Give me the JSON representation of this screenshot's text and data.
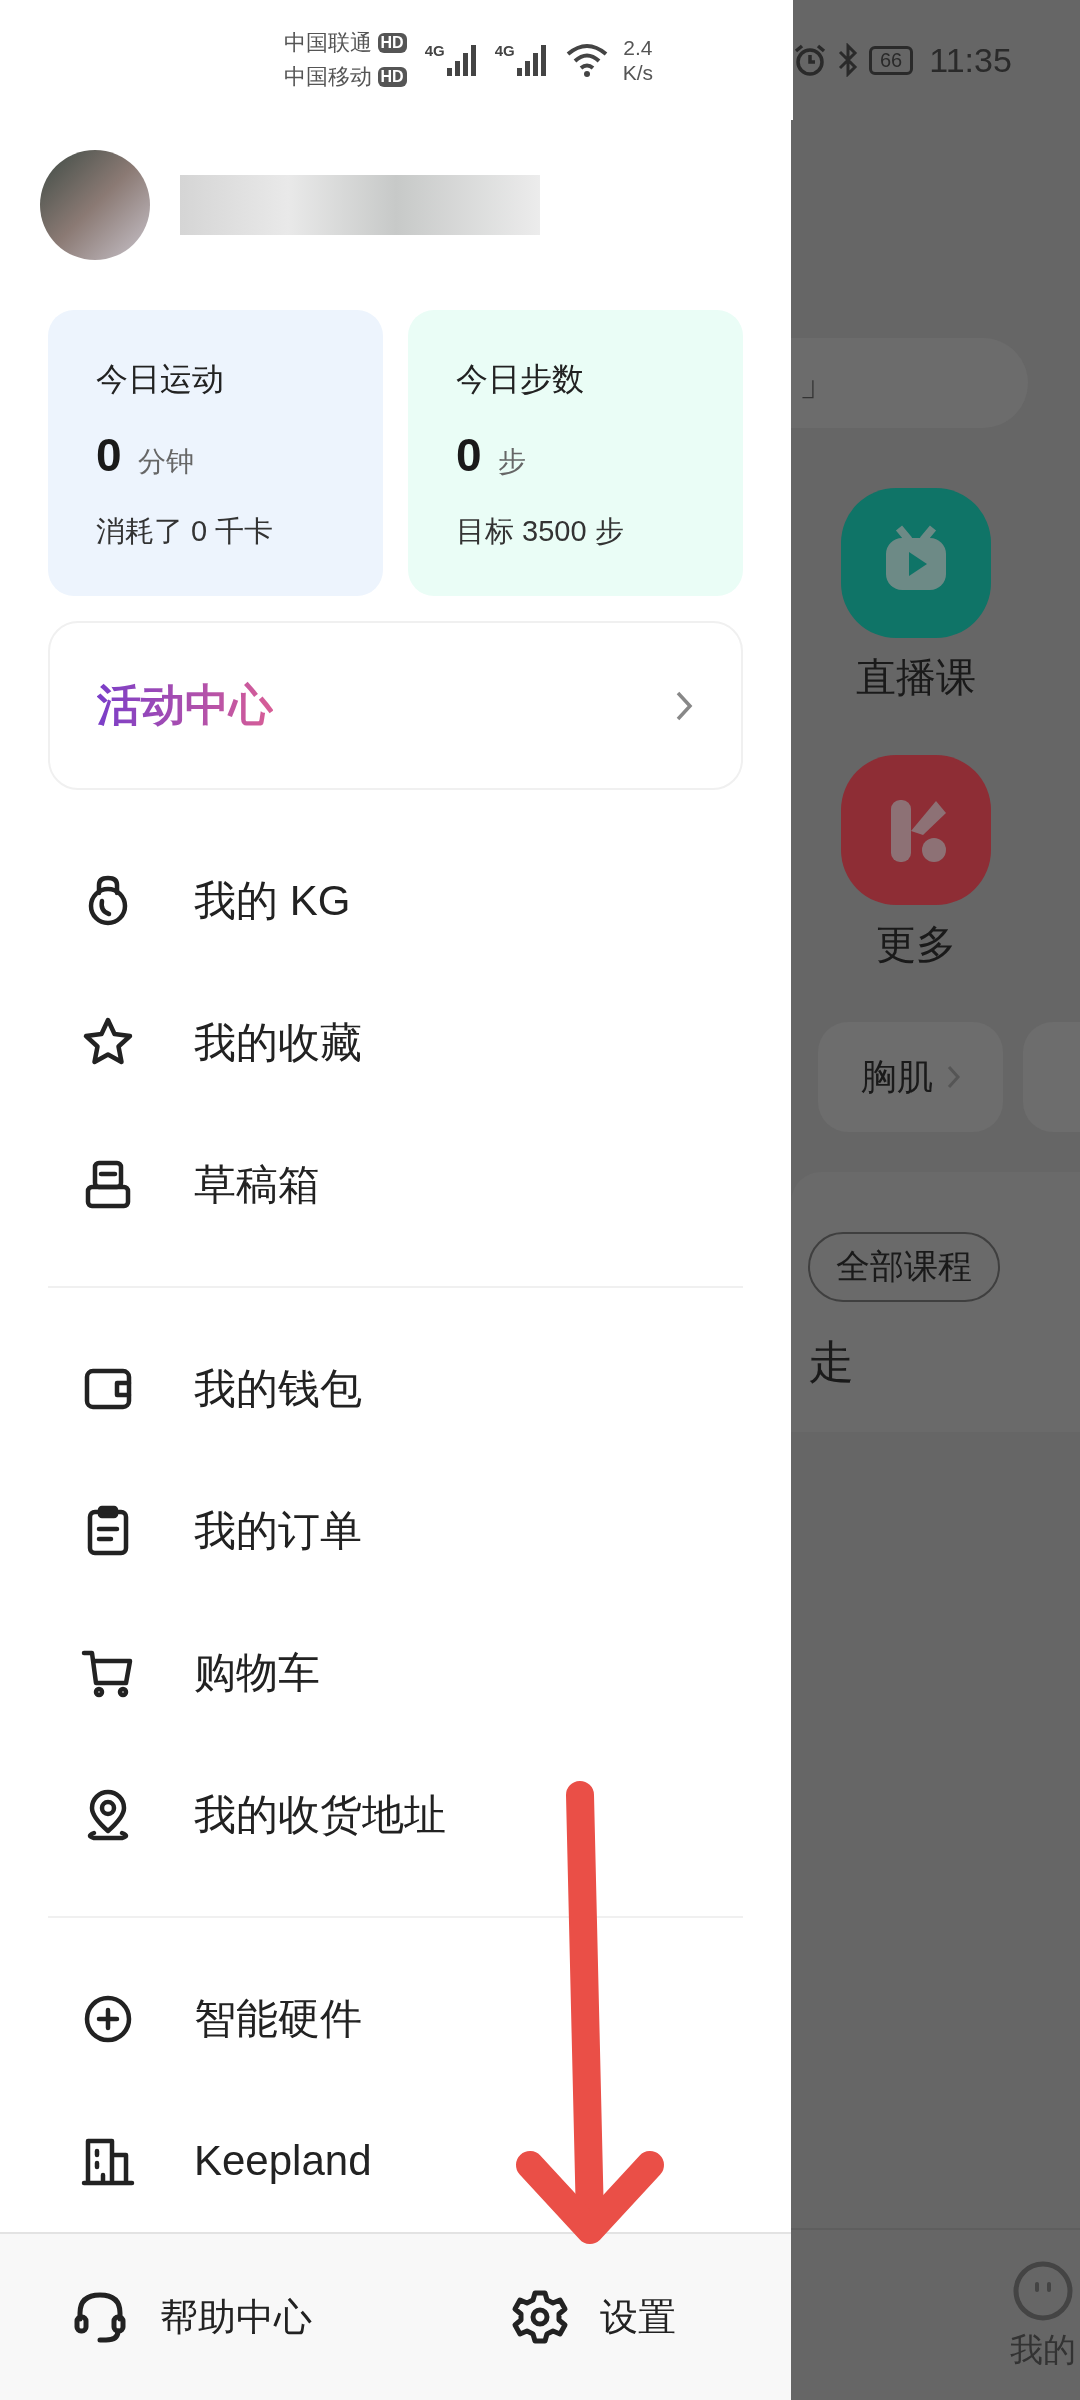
{
  "status_bar": {
    "carriers": [
      {
        "name": "中国联通",
        "badge": "HD"
      },
      {
        "name": "中国移动",
        "badge": "HD"
      }
    ],
    "signals": [
      {
        "label": "4G"
      },
      {
        "label": "4G"
      }
    ],
    "speed": [
      "2.4",
      "K/s"
    ],
    "battery": "66",
    "time": "11:35"
  },
  "stats": [
    {
      "title": "今日运动",
      "value": "0",
      "unit": "分钟",
      "note": "消耗了 0 千卡",
      "color": "#edf4fd"
    },
    {
      "title": "今日步数",
      "value": "0",
      "unit": "步",
      "note": "目标 3500 步",
      "color": "#eafdf6"
    }
  ],
  "activity": {
    "title": "活动中心"
  },
  "menu_groups": [
    [
      {
        "kind": "kettlebell",
        "label": "我的 KG"
      },
      {
        "kind": "star",
        "label": "我的收藏"
      },
      {
        "kind": "drafts",
        "label": "草稿箱"
      }
    ],
    [
      {
        "kind": "wallet",
        "label": "我的钱包"
      },
      {
        "kind": "orders",
        "label": "我的订单"
      },
      {
        "kind": "cart",
        "label": "购物车"
      },
      {
        "kind": "location",
        "label": "我的收货地址"
      }
    ],
    [
      {
        "kind": "plus",
        "label": "智能硬件"
      },
      {
        "kind": "building",
        "label": "Keepland"
      }
    ]
  ],
  "footer": [
    {
      "kind": "help",
      "label": "帮助中心"
    },
    {
      "kind": "settings",
      "label": "设置"
    }
  ],
  "background": {
    "search_fragment": "」",
    "shortcuts": [
      {
        "kind": "live",
        "label": "直播课",
        "color": "#0f7467"
      },
      {
        "kind": "more",
        "label": "更多",
        "color": "#8e2d35"
      }
    ],
    "chips": [
      {
        "label": "胸肌"
      }
    ],
    "courses_button": "全部课程",
    "heading_fragment": "走",
    "nav": [
      {
        "kind": "profile",
        "label": "我的"
      }
    ]
  },
  "annotation": {
    "kind": "arrow"
  }
}
